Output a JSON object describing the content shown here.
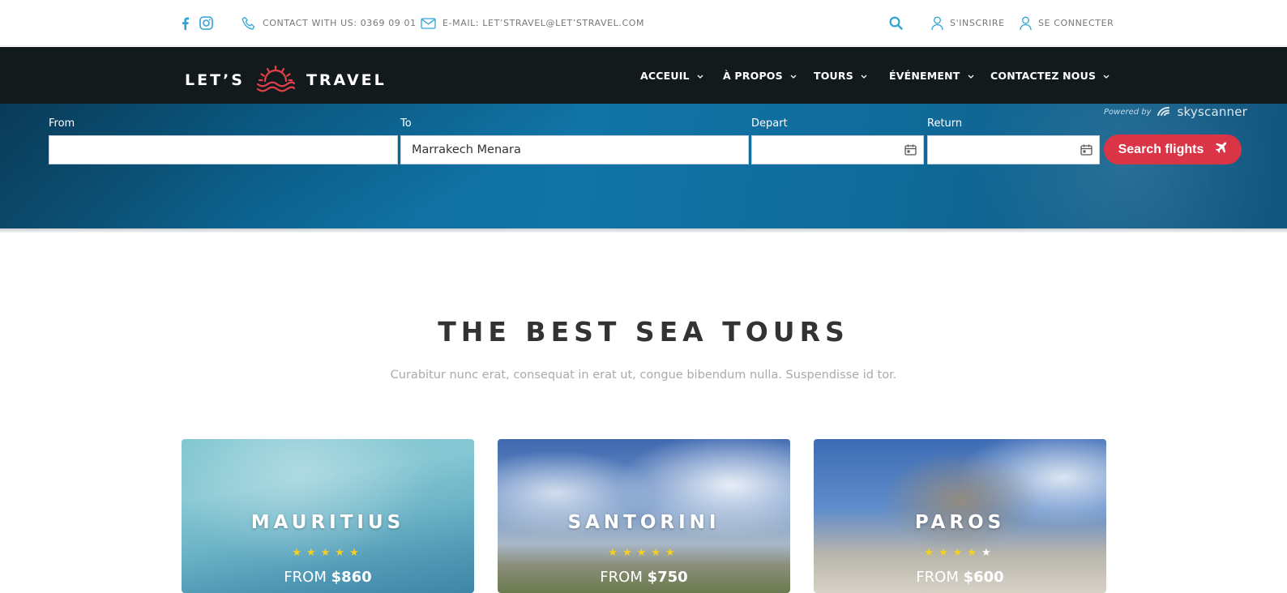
{
  "topbar": {
    "contact_label": "CONTACT WITH US: 0369 09 01",
    "email_label": "E-MAIL: LET’STRAVEL@LET’STRAVEL.COM",
    "signup_label": "S'INSCRIRE",
    "login_label": "SE CONNECTER"
  },
  "logo": {
    "left": "LET’S",
    "right": "TRAVEL"
  },
  "nav": {
    "items": [
      {
        "label": "ACCEUIL"
      },
      {
        "label": "À PROPOS"
      },
      {
        "label": "TOURS"
      },
      {
        "label": "ÉVÉNEMENT"
      },
      {
        "label": "CONTACTEZ NOUS"
      }
    ]
  },
  "flight_search": {
    "from_label": "From",
    "from_value": "",
    "to_label": "To",
    "to_value": "Marrakech Menara",
    "depart_label": "Depart",
    "return_label": "Return",
    "powered_by": "Powered by",
    "provider": "skyscanner",
    "search_button": "Search flights"
  },
  "tours": {
    "title": "THE BEST SEA TOURS",
    "subtitle": "Curabitur nunc erat, consequat in erat ut, congue bibendum nulla. Suspendisse id tor.",
    "cards": [
      {
        "name": "MAURITIUS",
        "rating": 5,
        "from_label": "FROM",
        "price": "$860"
      },
      {
        "name": "SANTORINI",
        "rating": 5,
        "from_label": "FROM",
        "price": "$750"
      },
      {
        "name": "PAROS",
        "rating": 4,
        "from_label": "FROM",
        "price": "$600"
      }
    ]
  },
  "colors": {
    "accent_blue": "#2ea3d6",
    "nav_bg": "#131a1c",
    "search_button": "#d93546",
    "star": "#f7d11b",
    "logo_sun": "#e0404a"
  }
}
